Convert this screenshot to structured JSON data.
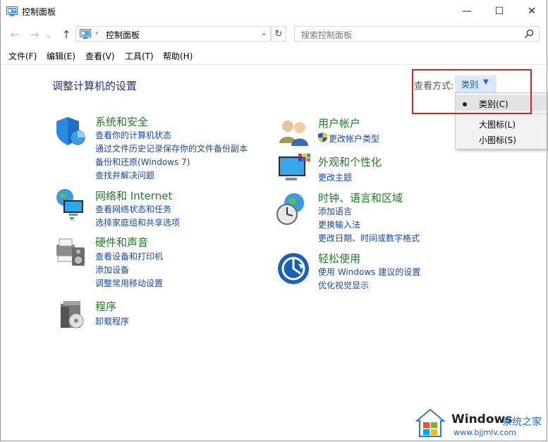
{
  "window": {
    "title": "控制面板",
    "minimize": "—",
    "maximize": "☐",
    "close": "✕"
  },
  "nav": {
    "back": "←",
    "forward": "→",
    "recent": "⌄",
    "up": "↑",
    "breadcrumb_sep": "›",
    "address": "控制面板",
    "address_dropdown": "⌄",
    "refresh": "↻",
    "search_placeholder": "搜索控制面板"
  },
  "menu": [
    "文件(F)",
    "编辑(E)",
    "查看(V)",
    "工具(T)",
    "帮助(H)"
  ],
  "header": {
    "title": "调整计算机的设置",
    "view_label": "查看方式:",
    "view_value": "类别",
    "view_arrow": "▼"
  },
  "view_dropdown": {
    "options": [
      "类别(C)",
      "大图标(L)",
      "小图标(S)"
    ],
    "selected_index": 0
  },
  "categories": [
    {
      "title": "系统和安全",
      "links": [
        "查看你的计算机状态",
        "通过文件历史记录保存你的文件备份副本",
        "备份和还原(Windows 7)",
        "查找并解决问题"
      ]
    },
    {
      "title": "网络和 Internet",
      "links": [
        "查看网络状态和任务",
        "选择家庭组和共享选项"
      ]
    },
    {
      "title": "硬件和声音",
      "links": [
        "查看设备和打印机",
        "添加设备",
        "调整常用移动设置"
      ]
    },
    {
      "title": "程序",
      "links": [
        "卸载程序"
      ]
    },
    {
      "title": "用户帐户",
      "links": [
        "更改帐户类型"
      ]
    },
    {
      "title": "外观和个性化",
      "links": [
        "更改主题"
      ]
    },
    {
      "title": "时钟、语言和区域",
      "links": [
        "添加语言",
        "更换输入法",
        "更改日期、时间或数字格式"
      ]
    },
    {
      "title": "轻松使用",
      "links": [
        "使用 Windows 建议的设置",
        "优化视觉显示"
      ]
    }
  ],
  "watermark": {
    "brand": "Windows",
    "suffix": "系统之家",
    "url": "www.bjjmlv.com"
  },
  "colors": {
    "category_title": "#237a2a",
    "link": "#1a4aa8",
    "highlight_box": "#e02020",
    "page_title": "#1e3287"
  }
}
